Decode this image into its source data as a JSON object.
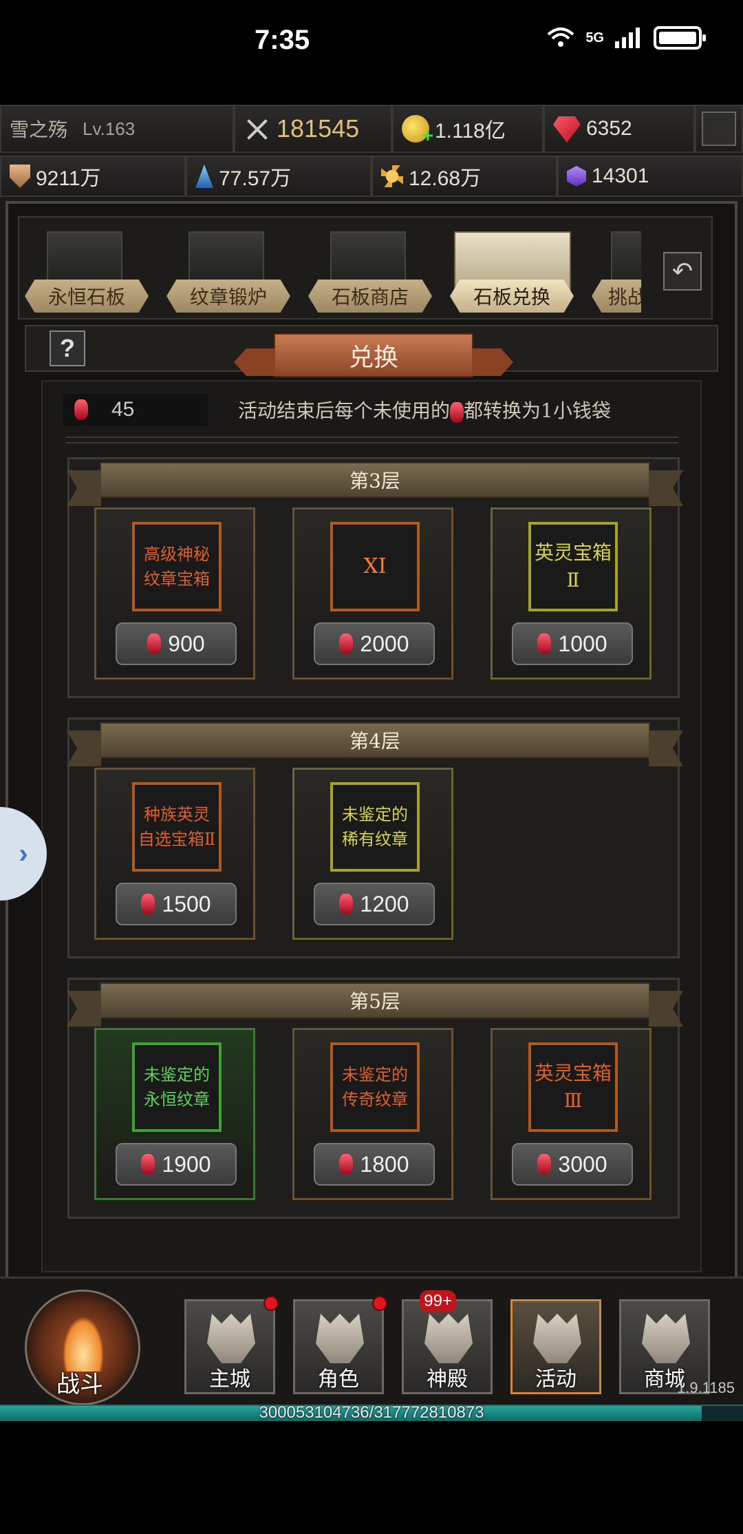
{
  "status_bar": {
    "time": "7:35",
    "network": "5G"
  },
  "resources": {
    "player_name": "雪之殇",
    "player_level": "Lv.163",
    "power": "181545",
    "gold": "1.118亿",
    "gems": "6352",
    "res_1": "9211万",
    "res_2": "77.57万",
    "res_3": "12.68万",
    "res_4": "14301"
  },
  "tabs": [
    {
      "label": "永恒石板"
    },
    {
      "label": "纹章锻炉"
    },
    {
      "label": "石板商店"
    },
    {
      "label": "石板兑换"
    },
    {
      "label": "挑战"
    }
  ],
  "header": {
    "title": "兑换",
    "help": "?"
  },
  "token": {
    "count": "45",
    "info_prefix": "活动结束后每个未使用的",
    "info_suffix": "都转换为1小钱袋"
  },
  "floors": [
    {
      "title": "第3层",
      "items": [
        {
          "name": "高级神秘纹章宝箱",
          "price": "900",
          "rarity": "orange"
        },
        {
          "name": "XI",
          "price": "2000",
          "rarity": "orange"
        },
        {
          "name": "英灵宝箱Ⅱ",
          "price": "1000",
          "rarity": "yellow"
        }
      ]
    },
    {
      "title": "第4层",
      "items": [
        {
          "name": "种族英灵自选宝箱Ⅱ",
          "price": "1500",
          "rarity": "orange"
        },
        {
          "name": "未鉴定的稀有纹章",
          "price": "1200",
          "rarity": "yellow"
        }
      ]
    },
    {
      "title": "第5层",
      "items": [
        {
          "name": "未鉴定的永恒纹章",
          "price": "1900",
          "rarity": "green"
        },
        {
          "name": "未鉴定的传奇纹章",
          "price": "1800",
          "rarity": "orange"
        },
        {
          "name": "英灵宝箱Ⅲ",
          "price": "3000",
          "rarity": "orange"
        }
      ]
    }
  ],
  "nav": {
    "fight": "战斗",
    "items": [
      {
        "label": "主城",
        "icon": "castle-icon"
      },
      {
        "label": "角色",
        "icon": "helmet-icon"
      },
      {
        "label": "神殿",
        "icon": "temple-icon",
        "badge": "99+"
      },
      {
        "label": "活动",
        "icon": "banner-icon"
      },
      {
        "label": "商城",
        "icon": "diamond-icon"
      }
    ],
    "version": "1.9.1185"
  },
  "xp": {
    "text": "300053104736/317772810873",
    "fraction": 0.944
  },
  "colors": {
    "orange_rarity": "#e0602a",
    "yellow_rarity": "#d9d44b",
    "green_rarity": "#5fd25b"
  }
}
